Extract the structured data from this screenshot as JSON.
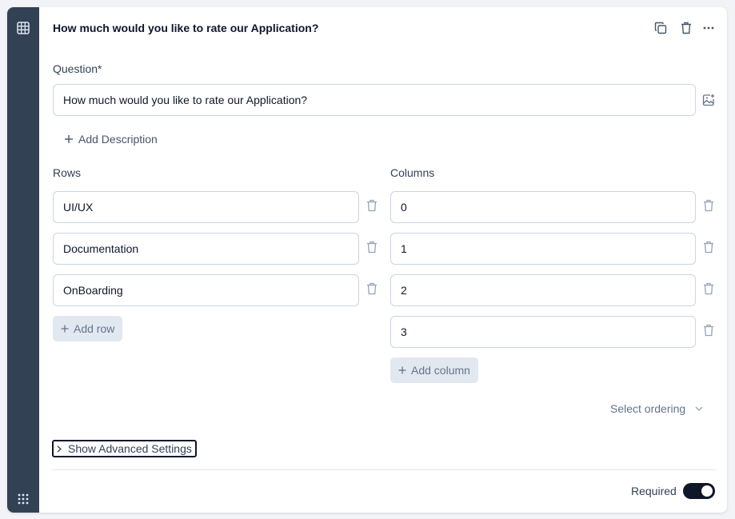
{
  "question_card": {
    "title": "How much would you like to rate our Application?",
    "question_label": "Question*",
    "question_value": "How much would you like to rate our Application?",
    "add_description_label": "Add Description",
    "rows_label": "Rows",
    "columns_label": "Columns",
    "rows": [
      {
        "value": "UI/UX"
      },
      {
        "value": "Documentation"
      },
      {
        "value": "OnBoarding"
      }
    ],
    "columns": [
      {
        "value": "0"
      },
      {
        "value": "1"
      },
      {
        "value": "2"
      },
      {
        "value": "3"
      }
    ],
    "add_row_label": "Add row",
    "add_column_label": "Add column",
    "select_ordering_label": "Select ordering",
    "advanced_settings_label": "Show Advanced Settings",
    "required_label": "Required",
    "required_on": true
  },
  "icons": {
    "side_top": "grid-icon",
    "side_bottom": "drag-handle-icon",
    "copy": "copy-icon",
    "delete": "trash-icon",
    "more": "more-horizontal-icon",
    "image": "image-add-icon"
  },
  "colors": {
    "sidebar": "#334155",
    "toggle_on": "#0f172a",
    "add_button_bg": "#e2e8f0"
  }
}
